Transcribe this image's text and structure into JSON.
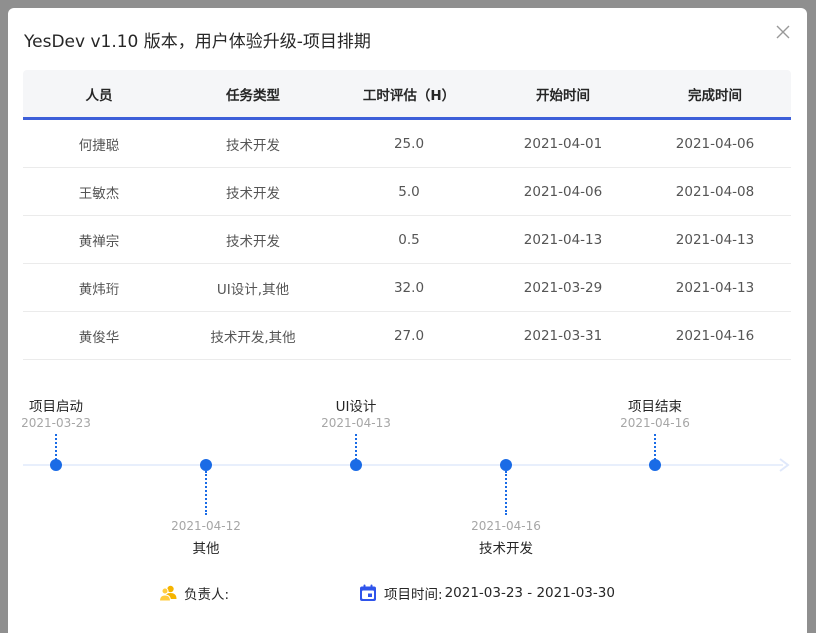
{
  "dialog": {
    "title": "YesDev v1.10 版本，用户体验升级-项目排期",
    "close_icon": "close-icon"
  },
  "table": {
    "headers": [
      "人员",
      "任务类型",
      "工时评估（H）",
      "开始时间",
      "完成时间"
    ],
    "rows": [
      [
        "何捷聪",
        "技术开发",
        "25.0",
        "2021-04-01",
        "2021-04-06"
      ],
      [
        "王敏杰",
        "技术开发",
        "5.0",
        "2021-04-06",
        "2021-04-08"
      ],
      [
        "黄禅宗",
        "技术开发",
        "0.5",
        "2021-04-13",
        "2021-04-13"
      ],
      [
        "黄炜珩",
        "UI设计,其他",
        "32.0",
        "2021-03-29",
        "2021-04-13"
      ],
      [
        "黄俊华",
        "技术开发,其他",
        "27.0",
        "2021-03-31",
        "2021-04-16"
      ]
    ],
    "accent_color": "#3d5fd9"
  },
  "timeline": {
    "accent_color": "#1a6be6",
    "milestones": [
      {
        "label": "项目启动",
        "date": "2021-03-23"
      },
      {
        "label": "其他",
        "date": "2021-04-12"
      },
      {
        "label": "UI设计",
        "date": "2021-04-13"
      },
      {
        "label": "技术开发",
        "date": "2021-04-16"
      },
      {
        "label": "项目结束",
        "date": "2021-04-16"
      }
    ]
  },
  "footer": {
    "owner_label": "负责人:",
    "owner_icon": "user-group-icon",
    "time_label": "项目时间:",
    "time_icon": "calendar-icon",
    "time_value": "2021-03-23 - 2021-03-30"
  }
}
